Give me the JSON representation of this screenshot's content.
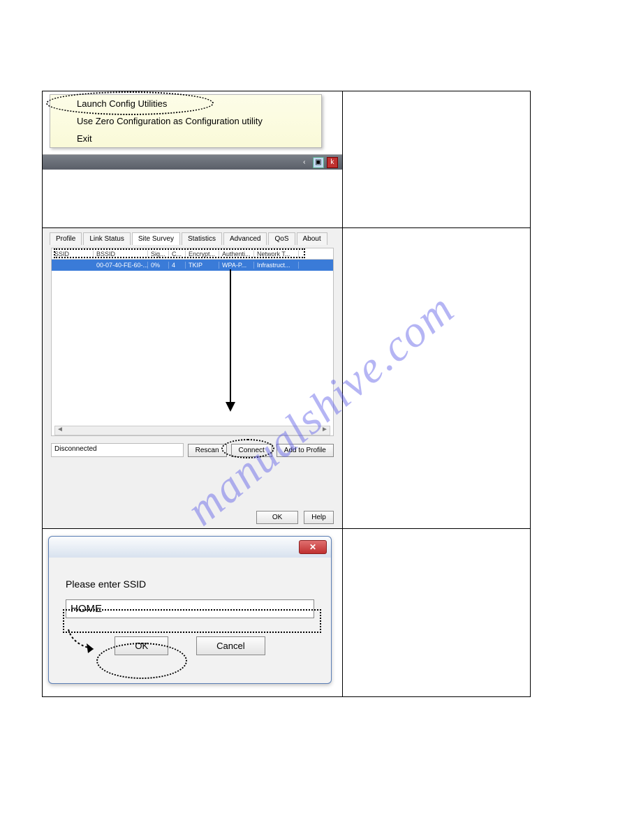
{
  "watermark": "manualshive.com",
  "context_menu": {
    "items": [
      "Launch Config Utilities",
      "Use Zero Configuration as Configuration utility",
      "Exit"
    ]
  },
  "survey": {
    "tabs": [
      "Profile",
      "Link Status",
      "Site Survey",
      "Statistics",
      "Advanced",
      "QoS",
      "About"
    ],
    "active_tab": "Site Survey",
    "columns": [
      "SSID",
      "BSSID",
      "Sig...",
      "C...",
      "Encrypt...",
      "Authenti...",
      "Network T..."
    ],
    "row": {
      "ssid": "",
      "bssid": "00-07-40-FE-60-...",
      "sig": "0%",
      "ch": "4",
      "enc": "TKIP",
      "auth": "WPA-P...",
      "net": "Infrastruct..."
    },
    "status": "Disconnected",
    "buttons": {
      "rescan": "Rescan",
      "connect": "Connect",
      "add": "Add to Profile"
    },
    "footer": {
      "ok": "OK",
      "help": "Help"
    }
  },
  "ssid_dialog": {
    "prompt": "Please enter SSID",
    "value": "HOME",
    "ok": "OK",
    "cancel": "Cancel"
  }
}
